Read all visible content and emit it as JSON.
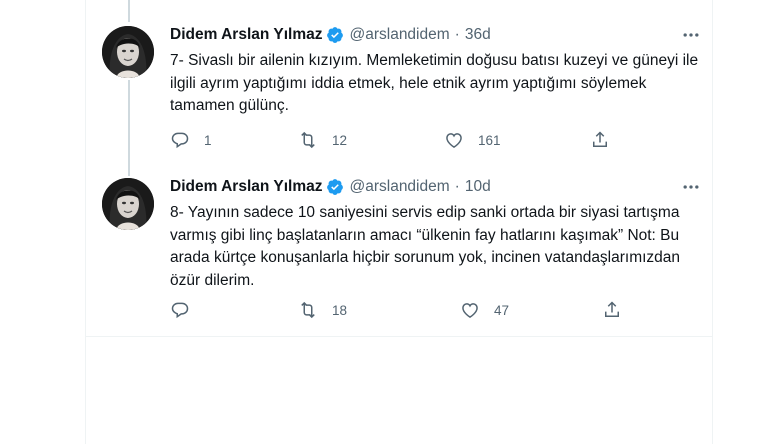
{
  "tweets": [
    {
      "name": "Didem Arslan Yılmaz",
      "handle": "@arslandidem",
      "separator": "·",
      "time": "36d",
      "text": "7- Sivaslı bir ailenin kızıyım. Memleketimin doğusu batısı kuzeyi ve güneyi ile ilgili ayrım yaptığımı iddia etmek, hele etnik ayrım yaptığımı söylemek tamamen gülünç.",
      "replies": "1",
      "retweets": "12",
      "likes": "161"
    },
    {
      "name": "Didem Arslan Yılmaz",
      "handle": "@arslandidem",
      "separator": "·",
      "time": "10d",
      "text": "8- Yayının sadece 10 saniyesini servis edip sanki ortada bir siyasi tartışma varmış gibi linç başlatanların amacı “ülkenin fay hatlarını kaşımak” Not: Bu arada kürtçe konuşanlarla hiçbir sorunum yok, incinen vatandaşlarımızdan özür dilerim.",
      "replies": "",
      "retweets": "18",
      "likes": "47"
    }
  ],
  "icons": {
    "verified": "verified-badge-icon",
    "more": "more-dots-icon",
    "reply": "reply-icon",
    "retweet": "retweet-icon",
    "like": "heart-icon",
    "share": "share-icon"
  },
  "colors": {
    "accent": "#1d9bf0",
    "text": "#0f1419",
    "muted": "#536471",
    "thread_line": "#cfd9de",
    "border": "#eff3f4"
  }
}
